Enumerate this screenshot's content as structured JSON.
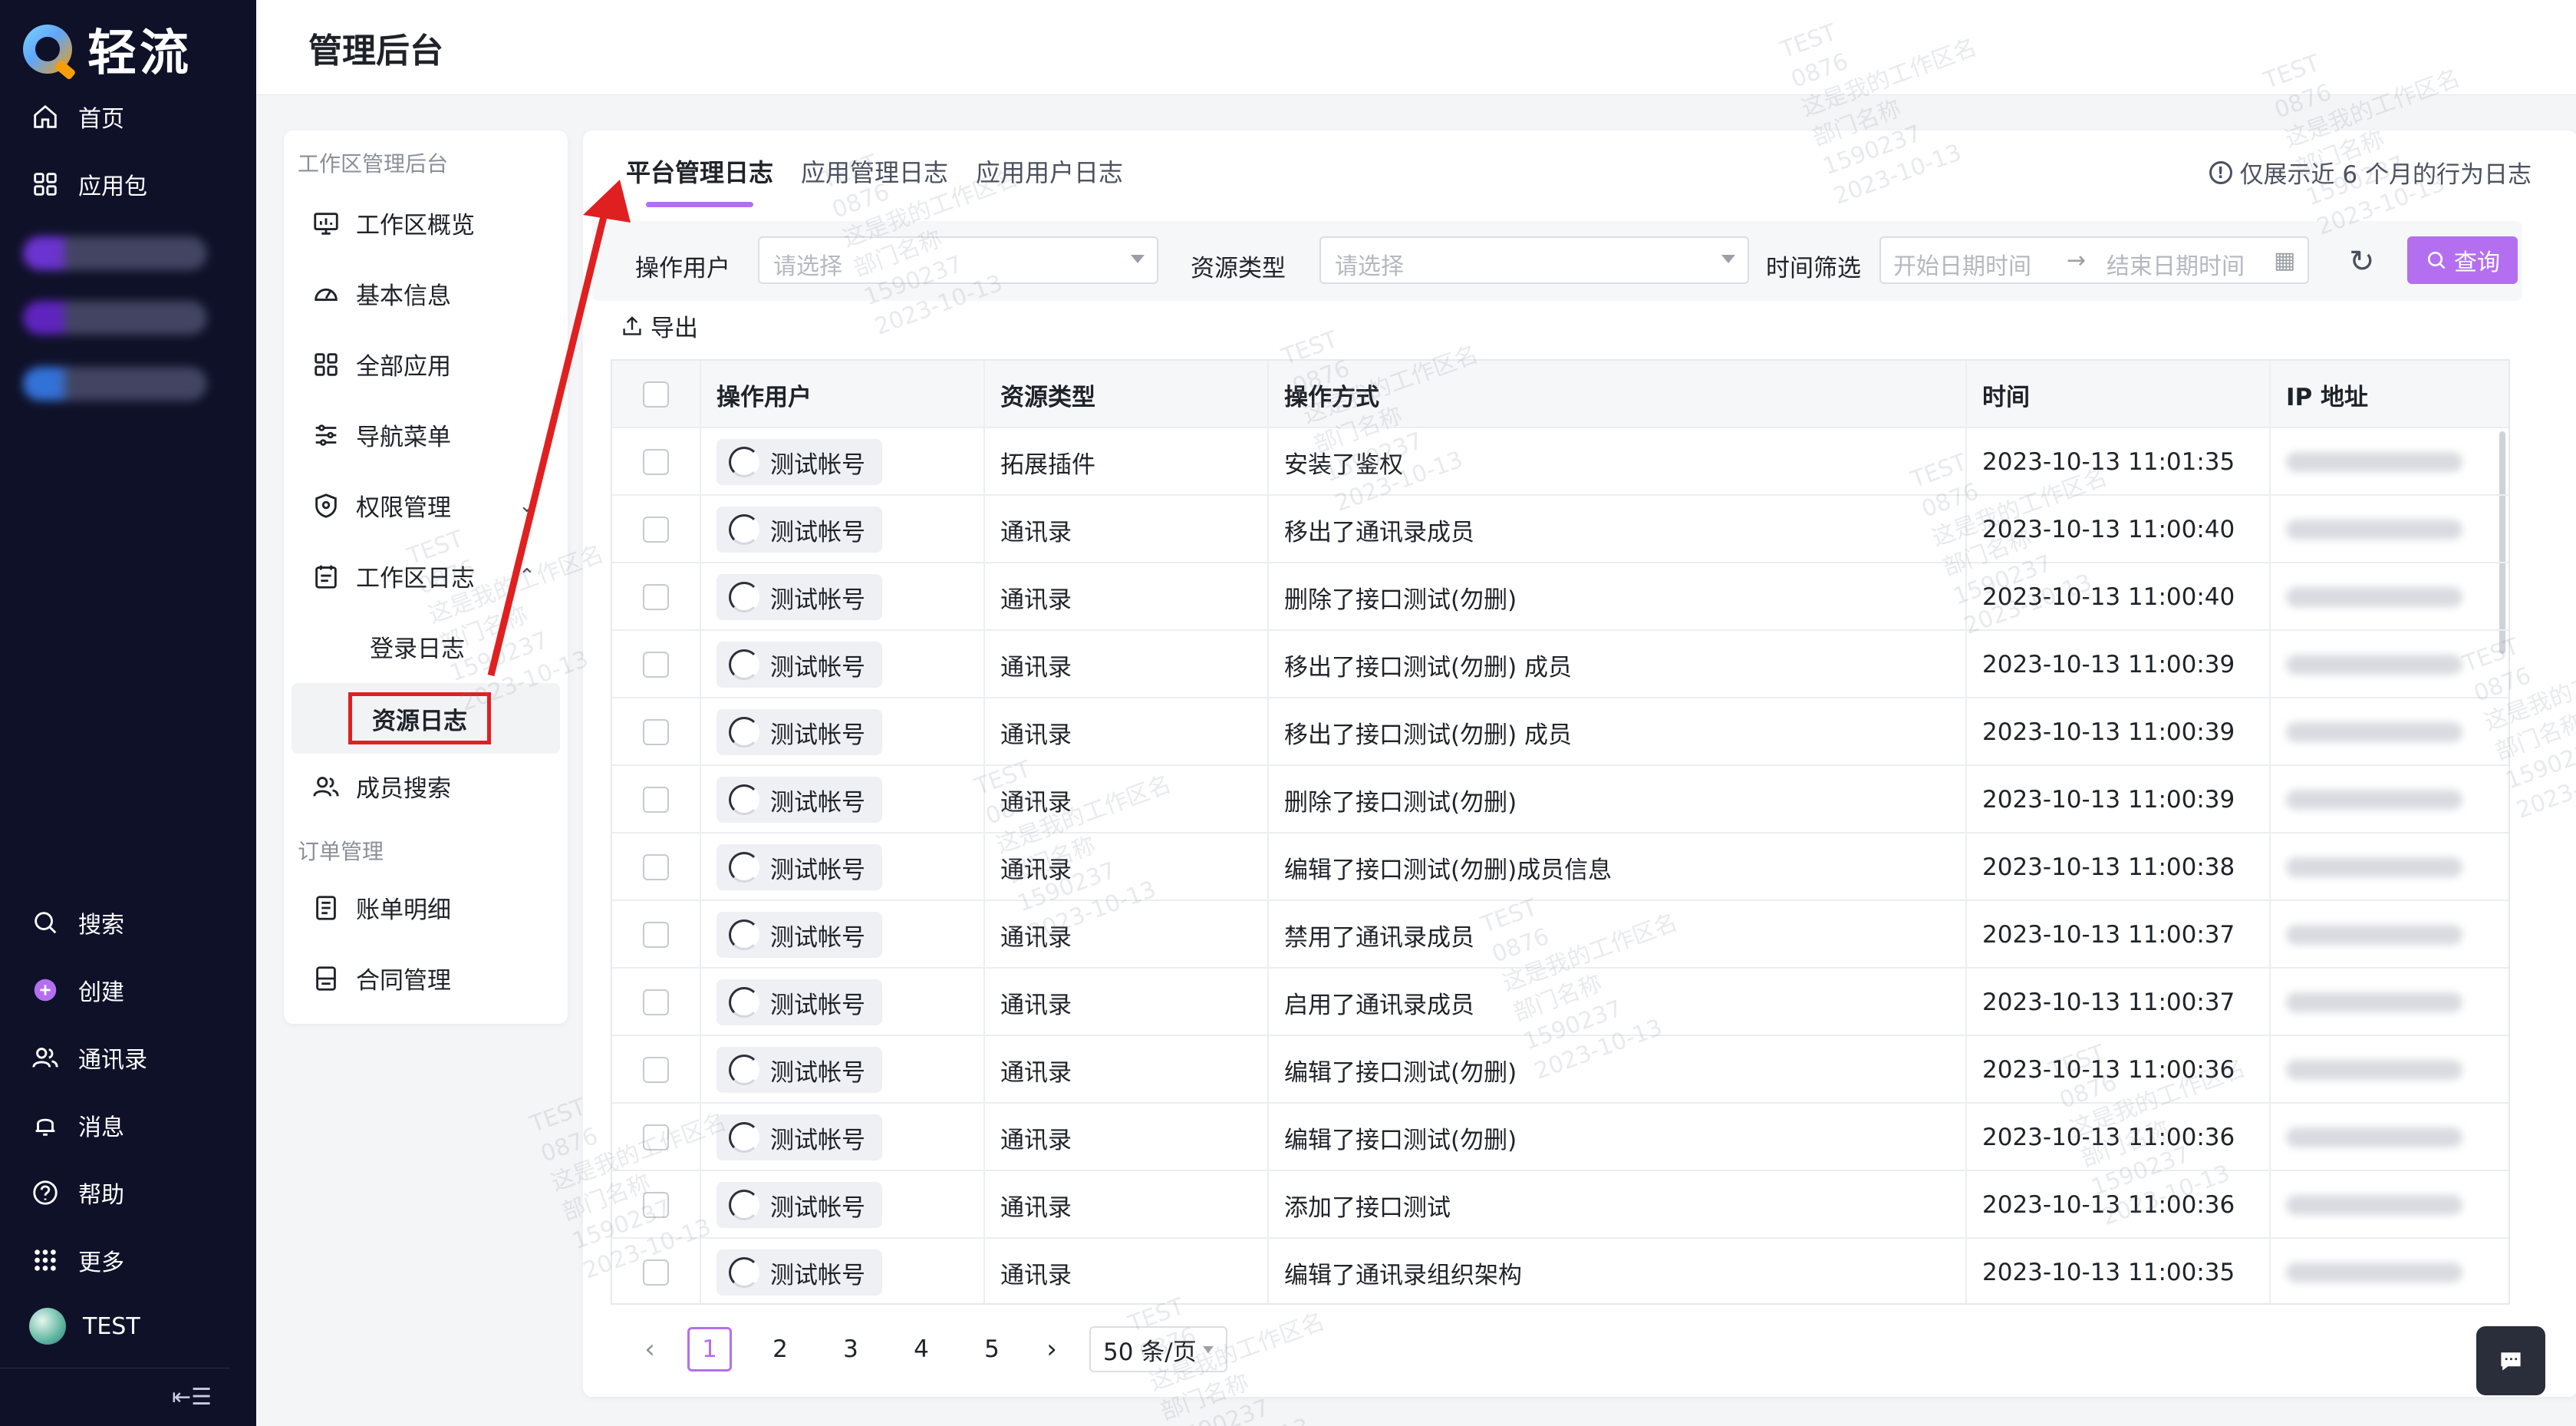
{
  "app": {
    "brand_name": "轻流"
  },
  "leftnav": {
    "top_items": [
      {
        "label": "首页",
        "icon": "home-icon"
      },
      {
        "label": "应用包",
        "icon": "apps-grid-icon"
      }
    ],
    "bottom_items": [
      {
        "label": "搜索",
        "icon": "search-icon"
      },
      {
        "label": "创建",
        "icon": "plus-circle-icon"
      },
      {
        "label": "通讯录",
        "icon": "contacts-icon"
      },
      {
        "label": "消息",
        "icon": "bell-icon"
      },
      {
        "label": "帮助",
        "icon": "help-icon"
      },
      {
        "label": "更多",
        "icon": "more-dots-icon"
      }
    ],
    "user_label": "TEST",
    "collapse_icon": "collapse-sidebar-icon"
  },
  "header": {
    "title": "管理后台"
  },
  "subnav": {
    "group1_title": "工作区管理后台",
    "items": [
      {
        "label": "工作区概览",
        "icon": "monitor-icon"
      },
      {
        "label": "基本信息",
        "icon": "dashboard-icon"
      },
      {
        "label": "全部应用",
        "icon": "grid-icon"
      },
      {
        "label": "导航菜单",
        "icon": "sliders-icon"
      },
      {
        "label": "权限管理",
        "icon": "shield-icon"
      },
      {
        "label": "工作区日志",
        "icon": "calendar-log-icon"
      }
    ],
    "log_children": [
      "登录日志",
      "资源日志"
    ],
    "member_search": {
      "label": "成员搜索",
      "icon": "users-icon"
    },
    "group2_title": "订单管理",
    "order_items": [
      {
        "label": "账单明细",
        "icon": "bill-icon"
      },
      {
        "label": "合同管理",
        "icon": "contract-icon"
      }
    ]
  },
  "tabs": [
    "平台管理日志",
    "应用管理日志",
    "应用用户日志"
  ],
  "notice": "仅展示近 6 个月的行为日志",
  "filters": {
    "operator_label": "操作用户",
    "operator_placeholder": "请选择",
    "resource_label": "资源类型",
    "resource_placeholder": "请选择",
    "time_label": "时间筛选",
    "start_placeholder": "开始日期时间",
    "end_placeholder": "结束日期时间",
    "query_label": "查询"
  },
  "export_label": "导出",
  "table": {
    "columns": [
      "操作用户",
      "资源类型",
      "操作方式",
      "时间",
      "IP 地址"
    ],
    "rows": [
      {
        "user": "测试帐号",
        "type": "拓展插件",
        "action": "安装了鉴权",
        "time": "2023-10-13 11:01:35"
      },
      {
        "user": "测试帐号",
        "type": "通讯录",
        "action": "移出了通讯录成员",
        "time": "2023-10-13 11:00:40"
      },
      {
        "user": "测试帐号",
        "type": "通讯录",
        "action": "删除了接口测试(勿删)",
        "time": "2023-10-13 11:00:40"
      },
      {
        "user": "测试帐号",
        "type": "通讯录",
        "action": "移出了接口测试(勿删) 成员",
        "time": "2023-10-13 11:00:39"
      },
      {
        "user": "测试帐号",
        "type": "通讯录",
        "action": "移出了接口测试(勿删) 成员",
        "time": "2023-10-13 11:00:39"
      },
      {
        "user": "测试帐号",
        "type": "通讯录",
        "action": "删除了接口测试(勿删)",
        "time": "2023-10-13 11:00:39"
      },
      {
        "user": "测试帐号",
        "type": "通讯录",
        "action": "编辑了接口测试(勿删)成员信息",
        "time": "2023-10-13 11:00:38"
      },
      {
        "user": "测试帐号",
        "type": "通讯录",
        "action": "禁用了通讯录成员",
        "time": "2023-10-13 11:00:37"
      },
      {
        "user": "测试帐号",
        "type": "通讯录",
        "action": "启用了通讯录成员",
        "time": "2023-10-13 11:00:37"
      },
      {
        "user": "测试帐号",
        "type": "通讯录",
        "action": "编辑了接口测试(勿删)",
        "time": "2023-10-13 11:00:36"
      },
      {
        "user": "测试帐号",
        "type": "通讯录",
        "action": "编辑了接口测试(勿删)",
        "time": "2023-10-13 11:00:36"
      },
      {
        "user": "测试帐号",
        "type": "通讯录",
        "action": "添加了接口测试",
        "time": "2023-10-13 11:00:36"
      },
      {
        "user": "测试帐号",
        "type": "通讯录",
        "action": "编辑了通讯录组织架构",
        "time": "2023-10-13 11:00:35"
      }
    ]
  },
  "pagination": {
    "pages": [
      "1",
      "2",
      "3",
      "4",
      "5"
    ],
    "current": "1",
    "page_size": "50 条/页"
  },
  "watermark": {
    "lines": [
      "TEST",
      "0876",
      "这是我的工作区名",
      "部门名称",
      "1590237",
      "2023-10-13"
    ]
  },
  "colors": {
    "accent": "#b46ff0",
    "nav_bg": "#0f1129",
    "annotation": "#e02020"
  }
}
